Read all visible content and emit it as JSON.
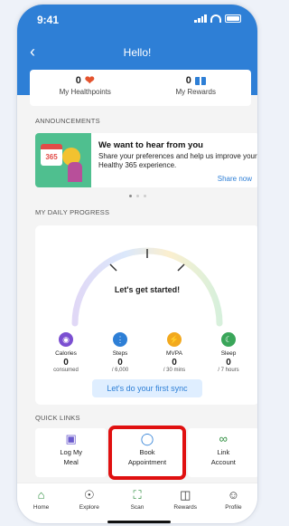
{
  "status_bar": {
    "time": "9:41"
  },
  "header": {
    "title": "Hello!"
  },
  "summary": {
    "healthpoints_value": "0",
    "healthpoints_label": "My Healthpoints",
    "rewards_value": "0",
    "rewards_label": "My Rewards"
  },
  "announcements": {
    "heading": "ANNOUNCEMENTS",
    "calendar_text": "365",
    "title": "We want to hear from you",
    "body": "Share your preferences and help us improve your Healthy 365 experience.",
    "link": "Share now"
  },
  "progress": {
    "heading": "MY DAILY PROGRESS",
    "gauge_label": "Let's get started!",
    "metrics": [
      {
        "name": "Calories",
        "value": "0",
        "unit": "consumed",
        "color": "#7b4fd1",
        "icon": "utensils-icon"
      },
      {
        "name": "Steps",
        "value": "0",
        "unit": "/ 6,000",
        "color": "#2e7fd6",
        "icon": "footsteps-icon"
      },
      {
        "name": "MVPA",
        "value": "0",
        "unit": "/ 30 mins",
        "color": "#f2a91e",
        "icon": "lightning-icon"
      },
      {
        "name": "Sleep",
        "value": "0",
        "unit": "/ 7 hours",
        "color": "#3aa65a",
        "icon": "moon-icon"
      }
    ],
    "sync_button": "Let's do your first sync"
  },
  "quick_links": {
    "heading": "QUICK LINKS",
    "items": [
      {
        "label_line1": "Log My",
        "label_line2": "Meal",
        "icon": "camera-icon"
      },
      {
        "label_line1": "Book",
        "label_line2": "Appointment",
        "icon": "stethoscope-icon"
      },
      {
        "label_line1": "Link",
        "label_line2": "Account",
        "icon": "link-icon"
      }
    ]
  },
  "tabbar": {
    "items": [
      {
        "label": "Home",
        "icon": "home-icon"
      },
      {
        "label": "Explore",
        "icon": "compass-icon"
      },
      {
        "label": "Scan",
        "icon": "scan-icon"
      },
      {
        "label": "Rewards",
        "icon": "gift-icon"
      },
      {
        "label": "Profile",
        "icon": "profile-icon"
      }
    ]
  },
  "colors": {
    "brand_blue": "#2e7fd6",
    "highlight_red": "#e01010"
  }
}
